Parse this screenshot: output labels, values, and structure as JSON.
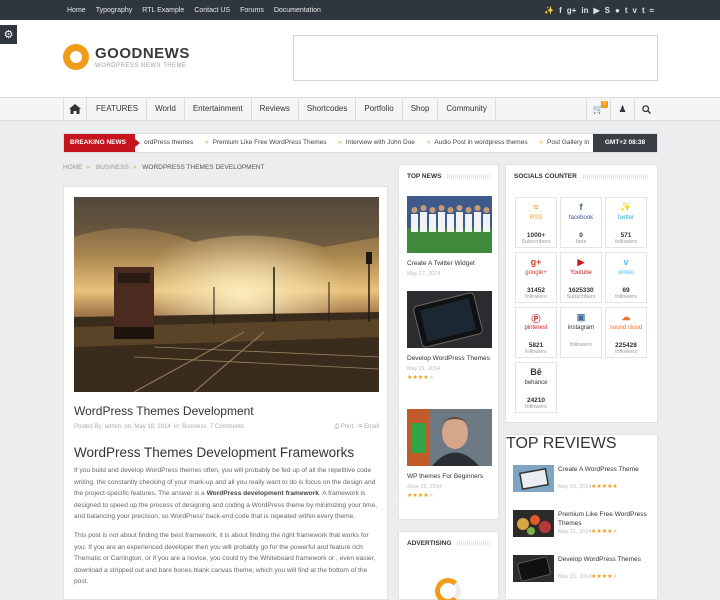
{
  "topbar": {
    "menu": [
      "Home",
      "Typography",
      "RTL Example",
      "Contact US",
      "Forums",
      "Documentation"
    ],
    "social_icons": [
      "twitter-icon",
      "facebook-icon",
      "googleplus-icon",
      "linkedin-icon",
      "youtube-icon",
      "skype-icon",
      "flickr-icon",
      "tumblr-icon",
      "vimeo-icon",
      "tumblr-t-icon",
      "rss-icon"
    ]
  },
  "logo": {
    "title": "GOODNEWS",
    "tagline": "WORDPRESS NEWS THEME"
  },
  "nav": {
    "items": [
      "FEATURES",
      "World",
      "Entertainment",
      "Reviews",
      "Shortcodes",
      "Portfolio",
      "Shop",
      "Community"
    ],
    "cart_count": "0"
  },
  "ticker": {
    "label": "BREAKING NEWS",
    "items": [
      "ordPress themes",
      "Premium Like Free WordPress Themes",
      "Interview with John Doe",
      "Audio Post in wordpress themes",
      "Post Gallery in"
    ],
    "clock": "GMT+2 08:38"
  },
  "breadcrumb": [
    "HOME",
    "BUSINESS",
    "WORDPRESS THEMES DEVELOPMENT"
  ],
  "article": {
    "title": "WordPress Themes Development",
    "meta_by": "Posted By: admin",
    "meta_on": "on: May 18, 2014",
    "meta_in": "in: Business",
    "meta_comments": "7 Comments",
    "print": "Print",
    "email": "Email",
    "heading": "WordPress Themes Development Frameworks",
    "p1_a": "If you build and develop WordPress themes often, you will probably be fed up of all the repetitive code writing, the constantly checking of your mark-up and all you really want to do is focus on the design and the project-specific features. The answer is a ",
    "p1_b": "WordPress development framework",
    "p1_c": ". A framework is designed to speed up the process of designing and coding a WordPress theme by minimizing your time, and balancing your precision, so WordPress' back-end code that is repeated within every theme.",
    "p2": "This post is not about finding the best framework, it is about finding the right framework that works for you. If you are an experienced developer then you will probably go for the powerful and feature rich Thematic or Carrington, or if you are a novice, you could try the Whiteboard framework or , even easier, download a stripped out and bare bones blank canvas theme, which you will find at the bottom of the post."
  },
  "top_news": {
    "title": "TOP NEWS",
    "items": [
      {
        "title": "Create A Twitter Widget",
        "date": "May 17, 2014",
        "rating": 0
      },
      {
        "title": "Develop WordPress Themes",
        "date": "May 21, 2014",
        "rating": 4
      },
      {
        "title": "WP themes For Beginners",
        "date": "June 26, 2014",
        "rating": 4
      }
    ]
  },
  "advertising": {
    "title": "ADVERTISING"
  },
  "socials": {
    "title": "SOCIALS COUNTER",
    "items": [
      {
        "name": "RSS",
        "count": "1000+",
        "unit": "Subscribers",
        "color": "#f29b18",
        "icon": "rss-icon"
      },
      {
        "name": "facebook",
        "count": "0",
        "unit": "fans",
        "color": "#3b5998",
        "icon": "facebook-icon"
      },
      {
        "name": "twitter",
        "count": "571",
        "unit": "followers",
        "color": "#2aa9e0",
        "icon": "twitter-icon"
      },
      {
        "name": "google+",
        "count": "31452",
        "unit": "followers",
        "color": "#d23e2b",
        "icon": "googleplus-icon"
      },
      {
        "name": "Youtube",
        "count": "1625330",
        "unit": "Subscribers",
        "color": "#cc181e",
        "icon": "youtube-icon"
      },
      {
        "name": "vimeo",
        "count": "69",
        "unit": "followers",
        "color": "#44bbff",
        "icon": "vimeo-icon"
      },
      {
        "name": "pinterest",
        "count": "5821",
        "unit": "followers",
        "color": "#cb2027",
        "icon": "pinterest-icon"
      },
      {
        "name": "instagram",
        "count": "",
        "unit": "followers",
        "color": "#3f729b",
        "icon": "instagram-icon"
      },
      {
        "name": "sound cloud",
        "count": "225428",
        "unit": "followers",
        "color": "#f26f23",
        "icon": "soundcloud-icon"
      },
      {
        "name": "behance",
        "count": "24210",
        "unit": "followers",
        "color": "#1769ff",
        "icon": "behance-icon"
      }
    ]
  },
  "top_reviews": {
    "title": "TOP REVIEWS",
    "items": [
      {
        "title": "Create A WordPress Theme",
        "date": "May 19, 2014",
        "rating": 4.5
      },
      {
        "title": "Premium Like Free WordPress Themes",
        "date": "May 21, 2014",
        "rating": 4
      },
      {
        "title": "Develop WordPress Themes",
        "date": "May 21, 2014",
        "rating": 4
      }
    ]
  }
}
